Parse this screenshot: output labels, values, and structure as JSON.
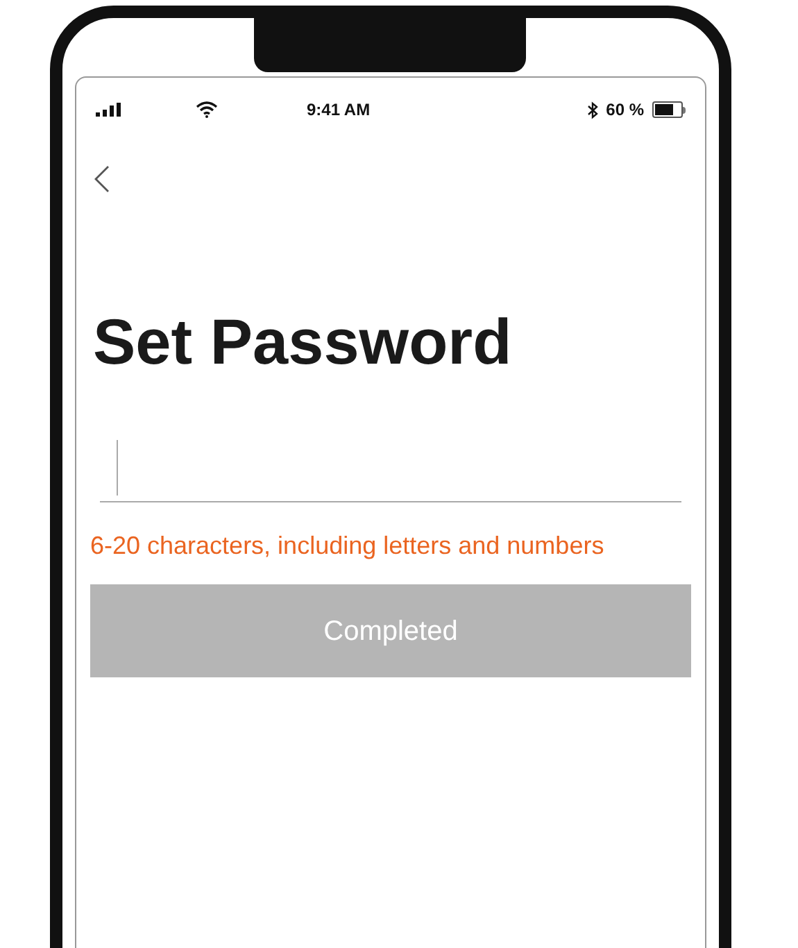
{
  "status_bar": {
    "time": "9:41 AM",
    "battery_text": "60 %"
  },
  "title": "Set Password",
  "password_field": {
    "focused": true
  },
  "hint": "6-20 characters, including letters and numbers",
  "submit_button": {
    "label": "Completed",
    "disabled": true
  }
}
